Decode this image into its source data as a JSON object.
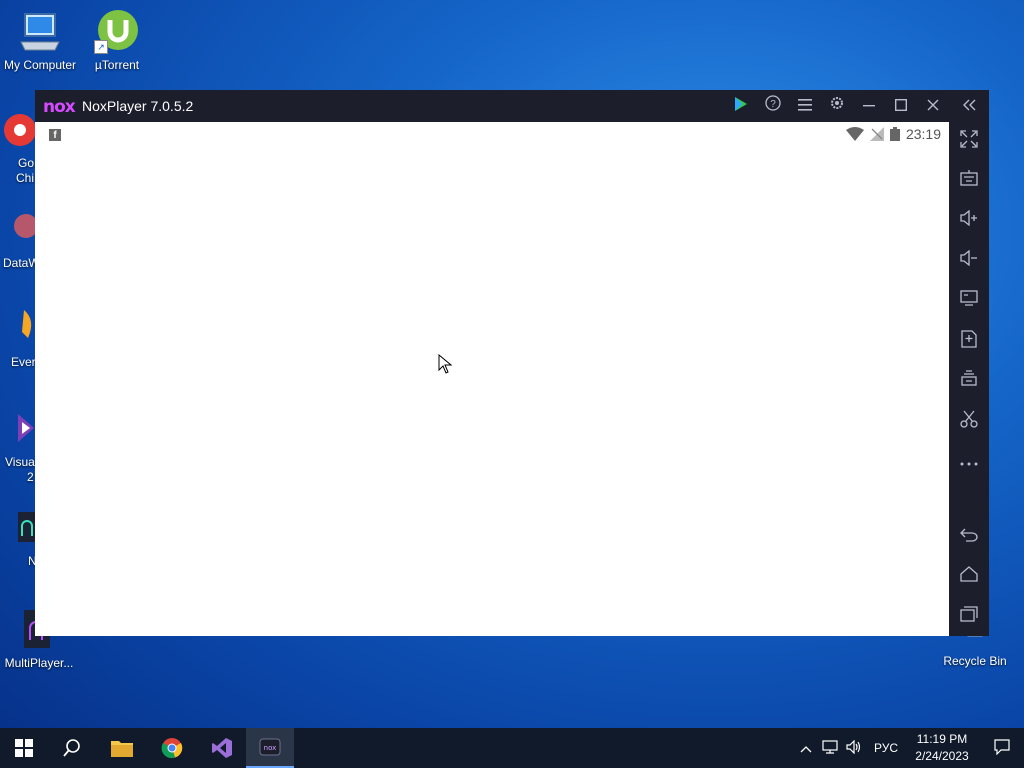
{
  "desktop": {
    "icons": [
      {
        "label": "My Computer"
      },
      {
        "label": "µTorrent"
      },
      {
        "label": "Recycle Bin"
      },
      {
        "label": "MultiPlayer..."
      }
    ],
    "partial_labels": [
      "Go",
      "Chi",
      "DataW",
      "Ever",
      "Visua",
      "2",
      "N"
    ]
  },
  "nox": {
    "logo": "nox",
    "title": "NoxPlayer 7.0.5.2",
    "status_time": "23:19",
    "titlebar_buttons": [
      "play-store-icon",
      "help-icon",
      "menu-icon",
      "settings-icon",
      "minimize-icon",
      "maximize-icon",
      "close-icon",
      "collapse-sidebar-icon"
    ],
    "sidebar_buttons": [
      "fullscreen-icon",
      "keyboard-icon",
      "volume-up-icon",
      "volume-down-icon",
      "screen-icon",
      "add-apk-icon",
      "multi-instance-icon",
      "screenshot-icon",
      "more-icon",
      "back-icon",
      "home-icon",
      "recent-apps-icon"
    ]
  },
  "taskbar": {
    "language": "РУС",
    "time": "11:19 PM",
    "date": "2/24/2023"
  }
}
